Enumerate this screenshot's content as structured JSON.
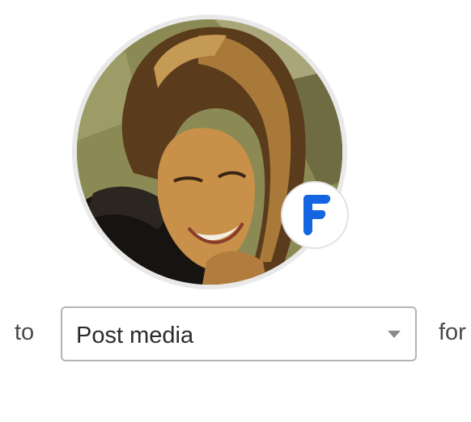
{
  "avatar": {
    "icon": "user-photo"
  },
  "badge": {
    "icon": "f-service-logo",
    "color": "#1565e0"
  },
  "sentence": {
    "prefix": "to",
    "suffix": "for"
  },
  "action_select": {
    "selected": "Post media",
    "icon": "caret-down-icon"
  }
}
